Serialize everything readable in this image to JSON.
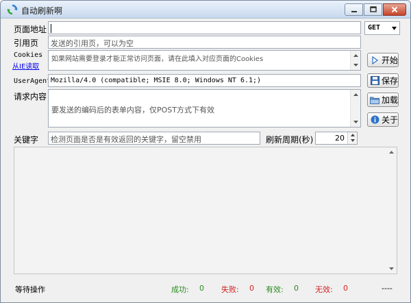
{
  "window": {
    "title": "自动刷新啊",
    "colors": {
      "title_grad_top": "#eaf2fb",
      "close_red": "#c7442a"
    }
  },
  "form": {
    "page_url": {
      "label": "页面地址",
      "value": ""
    },
    "method": {
      "selected": "GET"
    },
    "referer": {
      "label": "引用页",
      "placeholder": "发送的引用页，可以为空"
    },
    "cookies": {
      "label": "Cookies",
      "link": "从IE读取",
      "placeholder": "如果网站需要登录才能正常访问页面，请在此填入对应页面的Cookies"
    },
    "user_agent": {
      "label": "UserAgent",
      "value": "Mozilla/4.0 (compatible; MSIE 8.0; Windows NT 6.1;)"
    },
    "request_body": {
      "label": "请求内容",
      "placeholder": "要发送的编码后的表单内容，仅POST方式下有效"
    },
    "keyword": {
      "label": "关键字",
      "placeholder": "检测页面是否是有效返回的关键字，留空禁用"
    },
    "refresh_period": {
      "label": "刷新周期(秒)",
      "value": "20"
    }
  },
  "buttons": {
    "start": "开始",
    "save": "保存",
    "load": "加载",
    "about": "关于"
  },
  "status": {
    "state": "等待操作",
    "success_label": "成功:",
    "success_count": "0",
    "fail_label": "失败:",
    "fail_count": "0",
    "valid_label": "有效:",
    "valid_count": "0",
    "invalid_label": "无效:",
    "invalid_count": "0",
    "timer": "----"
  }
}
